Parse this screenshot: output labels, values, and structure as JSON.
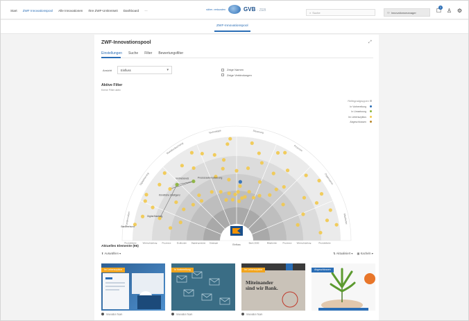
{
  "nav": {
    "items": [
      "Start",
      "ZWF Innovationspool",
      "Alle Innovationen",
      "Ihre ZWF-Umkreiseit",
      "Dashboard",
      "···"
    ]
  },
  "brand": {
    "claim": "näher. verbunden",
    "name": "GVB",
    "suffix": "· ZEB"
  },
  "search": {
    "placeholder": "Suche"
  },
  "user": {
    "label": "Innovationsmanager"
  },
  "notifications": {
    "count": "1"
  },
  "subnav": {
    "active": "ZWF-Innovationspool"
  },
  "card": {
    "title": "ZWF-Innovationspool",
    "tabs": [
      "Einstellungen",
      "Suche",
      "Filter",
      "Bewertungsfilter"
    ],
    "filter_label": "Ansicht",
    "select_value": "Einfluss",
    "checks": [
      "Zeige Namen",
      "Zeige Verbindungen"
    ],
    "active_filter_title": "Aktive Filter",
    "active_filter_sub": "Keine Filter aktiv"
  },
  "legend": {
    "title": "Reifegradgruppen",
    "items": [
      {
        "label": "In Vorbereitung",
        "color": "#2a6db5"
      },
      {
        "label": "In Umsetzung",
        "color": "#8ab43a"
      },
      {
        "label": "Im Lebenszyklus",
        "color": "#f2c94c"
      },
      {
        "label": "Abgeschlossen",
        "color": "#b8872c"
      }
    ]
  },
  "radar": {
    "sector_labels": [
      "Kundennutzen",
      "Digitalisierung",
      "Marktbeobachtung",
      "Technologie",
      "Steuerung",
      "Prozesse",
      "Organisation",
      "Mitarbeiter"
    ],
    "annotations": [
      "Vertriebsnetz",
      "Prozessautomatisierung",
      "Digital Banking",
      "Künstliche Intelligenz",
      "Bankverbund"
    ],
    "baseline_labels": [
      "Produktkette",
      "Wertschöpfung",
      "Prozesse",
      "Endkunde",
      "Digital-gestützt",
      "Strategie",
      "Bank 2030",
      "Mitarbeiter",
      "Prozesse",
      "Wertschöpfung",
      "Produktkette"
    ],
    "center_label": "Einfluss"
  },
  "elements": {
    "title": "Aktuelles Elemente (96)",
    "actions": "Auswählen",
    "sort": "Aktualisiert",
    "view": "Kacheln",
    "tiles": [
      {
        "tag": "Im Lebenszyklus",
        "tag_color": "#f2a51e",
        "author": "Innovation Team"
      },
      {
        "tag": "In Vorbereitung",
        "tag_color": "#f2a51e",
        "author": "Innovation Team"
      },
      {
        "tag": "Im Lebenszyklus",
        "tag_color": "#f2a51e",
        "author": "Innovation Team",
        "headline": "Miteinander sind wir Bank."
      },
      {
        "tag": "Abgeschlossen",
        "tag_color": "#2a6db5",
        "author": ""
      }
    ]
  }
}
